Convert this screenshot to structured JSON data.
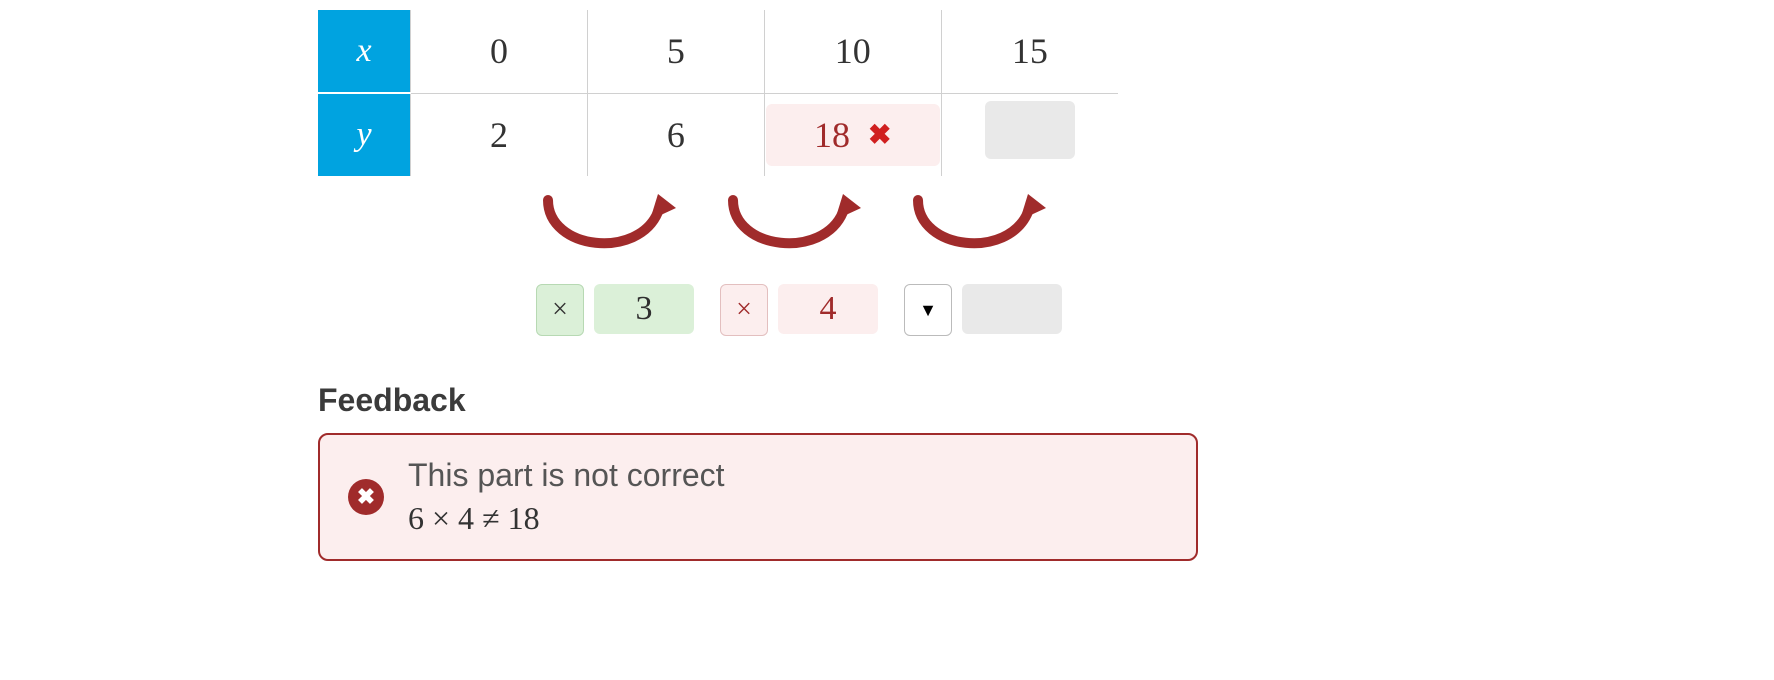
{
  "table": {
    "row_x": {
      "label": "x",
      "cells": [
        "0",
        "5",
        "10",
        "15"
      ]
    },
    "row_y": {
      "label": "y",
      "cells": [
        {
          "value": "2",
          "state": "plain"
        },
        {
          "value": "6",
          "state": "plain"
        },
        {
          "value": "18",
          "state": "wrong"
        },
        {
          "value": "",
          "state": "empty"
        }
      ]
    }
  },
  "ops": [
    {
      "symbol": "×",
      "value": "3",
      "state": "correct"
    },
    {
      "symbol": "×",
      "value": "4",
      "state": "wrong"
    },
    {
      "symbol": "▼",
      "value": "",
      "state": "blank"
    }
  ],
  "feedback": {
    "heading": "Feedback",
    "line1": "This part is not correct",
    "line2": "6 × 4 ≠ 18"
  }
}
